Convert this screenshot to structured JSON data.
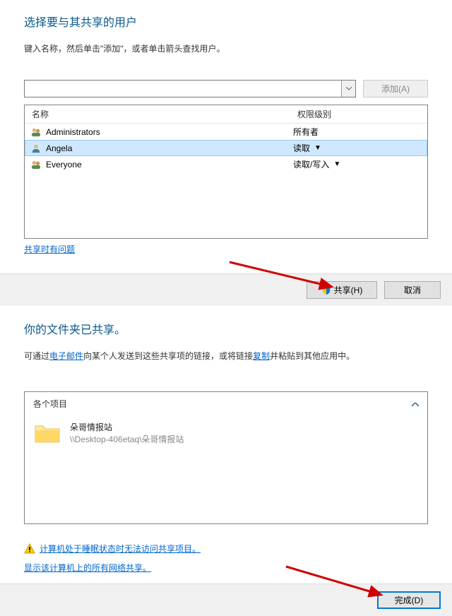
{
  "share_select": {
    "title": "选择要与其共享的用户",
    "instruction": "键入名称，然后单击\"添加\"，或者单击箭头查找用户。",
    "add_button": "添加(A)",
    "columns": {
      "name": "名称",
      "permission": "权限级别"
    },
    "rows": [
      {
        "icon": "group",
        "name": "Administrators",
        "permission": "所有者",
        "has_dropdown": false,
        "selected": false
      },
      {
        "icon": "user",
        "name": "Angela",
        "permission": "读取",
        "has_dropdown": true,
        "selected": true
      },
      {
        "icon": "group",
        "name": "Everyone",
        "permission": "读取/写入",
        "has_dropdown": true,
        "selected": false
      }
    ],
    "problem_link": "共享时有问题",
    "share_button": "共享(H)",
    "cancel_button": "取消"
  },
  "shared_confirm": {
    "title": "你的文件夹已共享。",
    "description_pre": "可通过",
    "email_link": "电子邮件",
    "description_mid": "向某个人发送到这些共享项的链接，或将链接",
    "copy_link": "复制",
    "description_post": "并粘贴到其他应用中。",
    "items_header": "各个项目",
    "item": {
      "name": "朵哥情报站",
      "path": "\\\\Desktop-406etaq\\朵哥情报站"
    },
    "sleep_warning": "计算机处于睡眠状态时无法访问共享项目。",
    "show_all_link": "显示该计算机上的所有网络共享。",
    "done_button": "完成(D)"
  }
}
